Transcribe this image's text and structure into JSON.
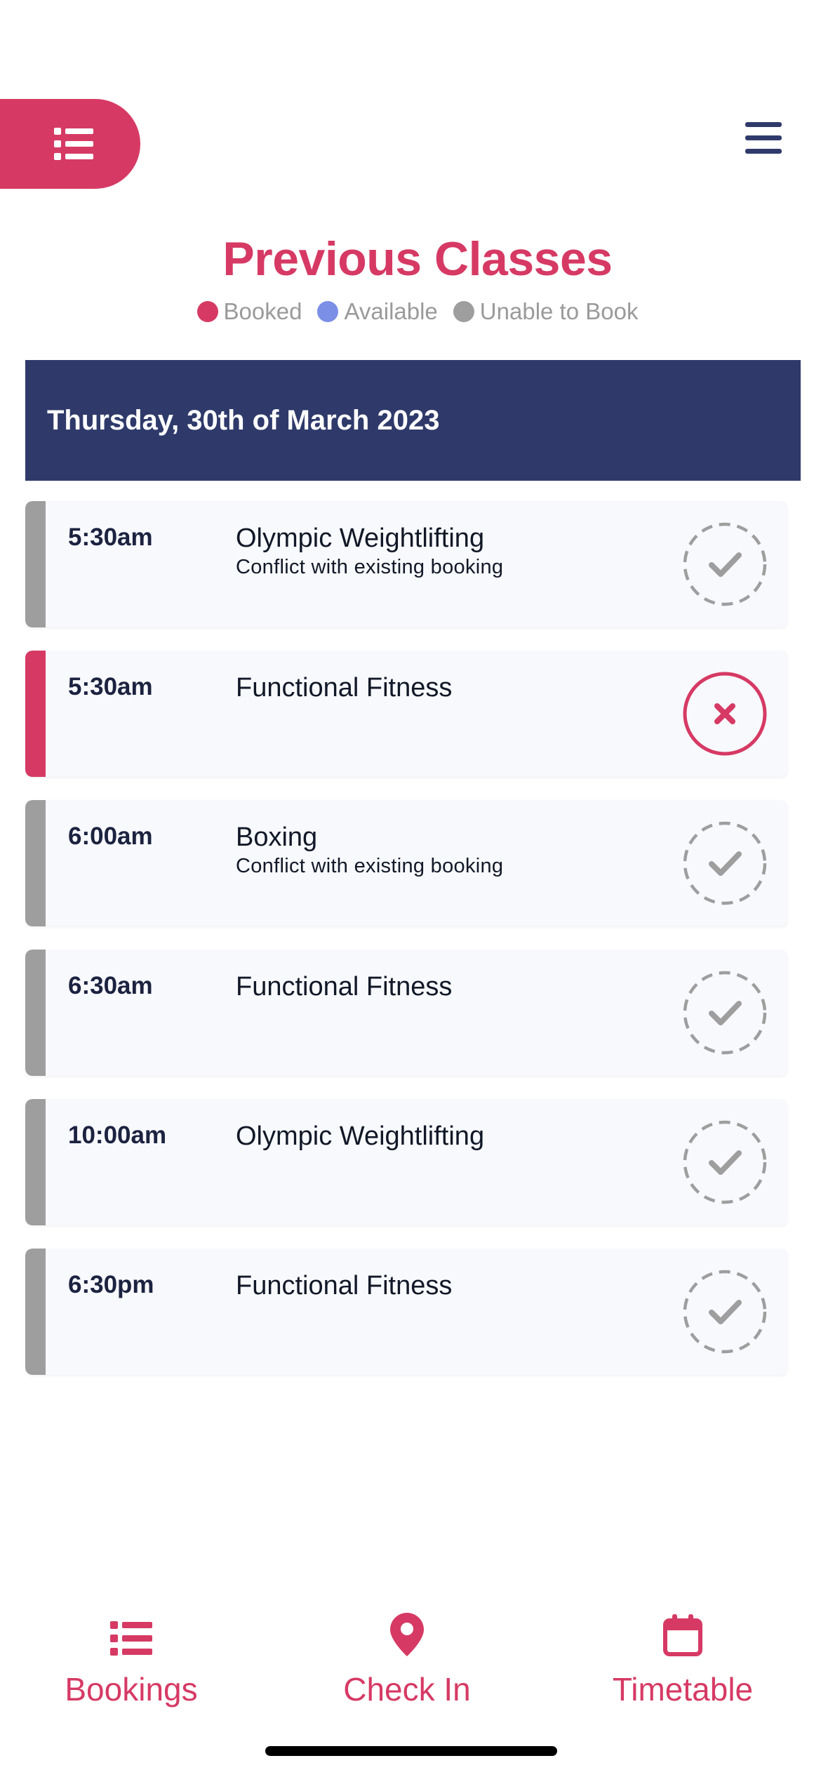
{
  "page": {
    "title": "Previous Classes"
  },
  "legend": [
    {
      "label": "Booked",
      "color": "#d63a64"
    },
    {
      "label": "Available",
      "color": "#7b8fe6"
    },
    {
      "label": "Unable to Book",
      "color": "#9e9e9e"
    }
  ],
  "date_header": "Thursday, 30th of March 2023",
  "classes": [
    {
      "time": "5:30am",
      "name": "Olympic Weightlifting",
      "note": "Conflict with existing booking",
      "status": "unable",
      "action": "check-icon"
    },
    {
      "time": "5:30am",
      "name": "Functional Fitness",
      "note": "",
      "status": "booked",
      "action": "cancel-icon"
    },
    {
      "time": "6:00am",
      "name": "Boxing",
      "note": "Conflict with existing booking",
      "status": "unable",
      "action": "check-icon"
    },
    {
      "time": "6:30am",
      "name": "Functional Fitness",
      "note": "",
      "status": "unable",
      "action": "check-icon"
    },
    {
      "time": "10:00am",
      "name": "Olympic Weightlifting",
      "note": "",
      "status": "unable",
      "action": "check-icon"
    },
    {
      "time": "6:30pm",
      "name": "Functional Fitness",
      "note": "",
      "status": "unable",
      "action": "check-icon"
    }
  ],
  "bottom_nav": [
    {
      "label": "Bookings",
      "icon": "list-icon"
    },
    {
      "label": "Check In",
      "icon": "location-pin-icon"
    },
    {
      "label": "Timetable",
      "icon": "calendar-icon"
    }
  ],
  "colors": {
    "accent": "#d63a64",
    "header": "#2f3a6b",
    "unable": "#9e9e9e",
    "available": "#7b8fe6"
  }
}
